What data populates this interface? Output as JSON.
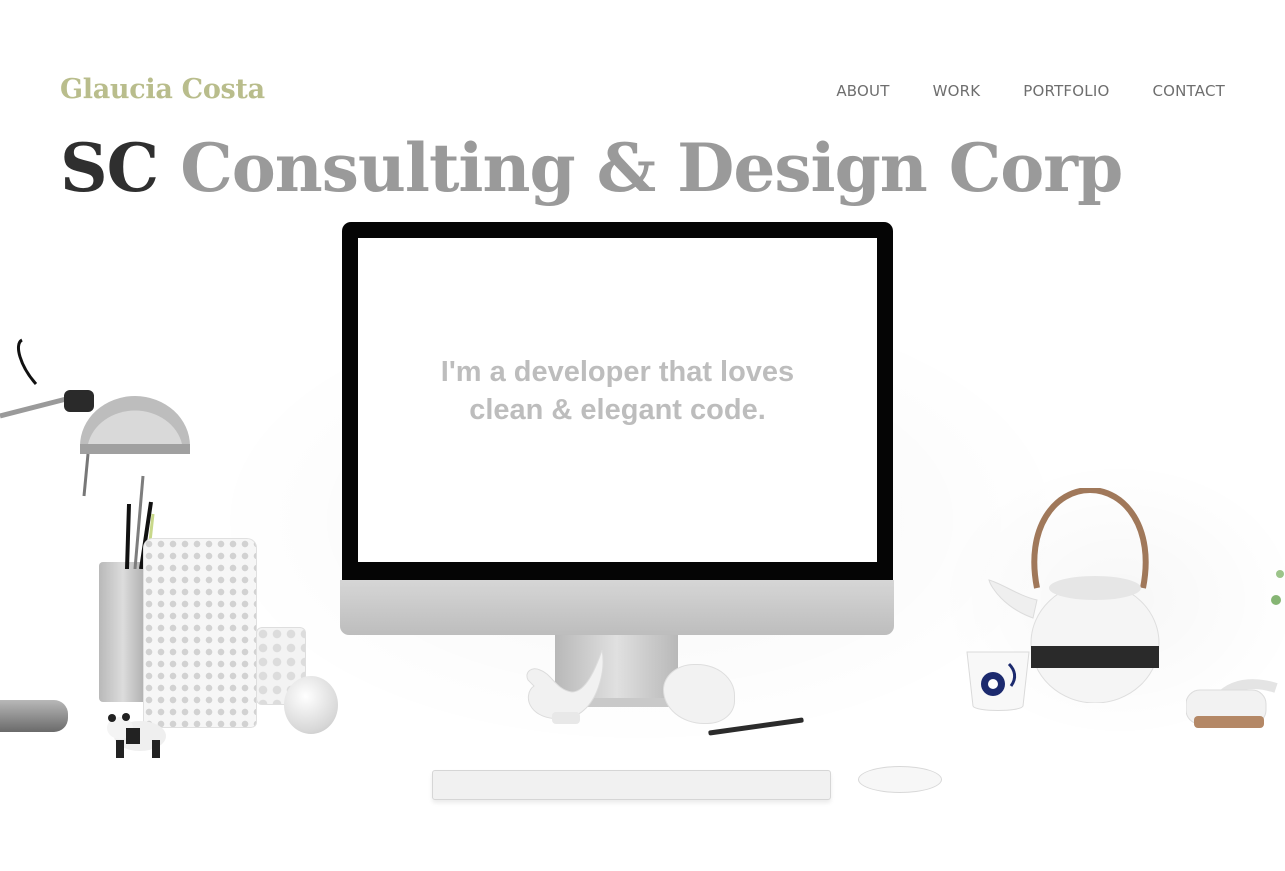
{
  "brand": {
    "name": "Glaucia Costa",
    "color": "#b9bd8c"
  },
  "nav": {
    "items": [
      {
        "label": "ABOUT"
      },
      {
        "label": "WORK"
      },
      {
        "label": "PORTFOLIO"
      },
      {
        "label": "CONTACT"
      }
    ]
  },
  "hero": {
    "headline_strong": "SC",
    "headline_light": "Consulting & Design Corp",
    "screen_text": "I'm a developer that loves clean & elegant code."
  },
  "colors": {
    "background": "#ffffff",
    "headline_dark": "#2f2f2f",
    "headline_gray": "#9a9a9a",
    "nav_text": "#6e6e6e",
    "screen_text": "#bdbdbd"
  }
}
